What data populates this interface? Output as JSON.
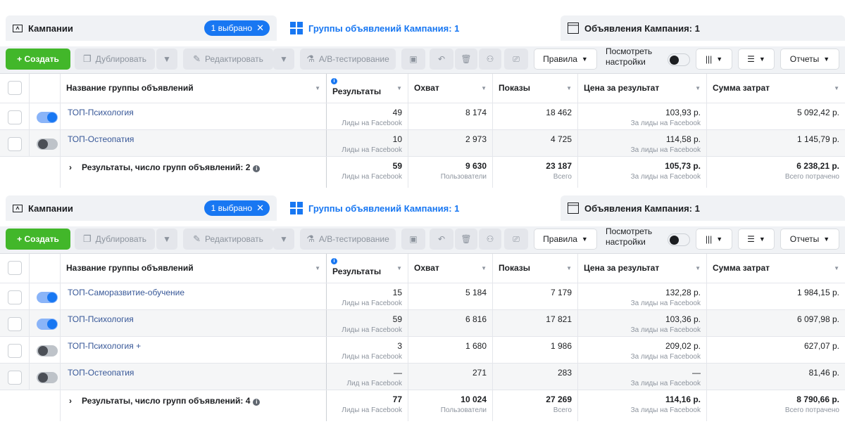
{
  "colors": {
    "accent": "#1877f2",
    "create": "#42b72a",
    "link": "#385898"
  },
  "panels": [
    {
      "tabs": {
        "campaigns": "Кампании",
        "selected_pill": "1 выбрано",
        "ad_sets": "Группы объявлений Кампания: 1",
        "ads": "Объявления Кампания: 1"
      },
      "toolbar": {
        "create": "+ Создать",
        "duplicate": "Дублировать",
        "edit": "Редактировать",
        "ab_test": "A/B-тестирование",
        "rules": "Правила",
        "view_settings_1": "Посмотреть",
        "view_settings_2": "настройки",
        "reports": "Отчеты"
      },
      "columns": {
        "name": "Название группы объявлений",
        "results": "Результаты",
        "reach": "Охват",
        "impressions": "Показы",
        "cost_per_result": "Цена за результат",
        "amount_spent": "Сумма затрат"
      },
      "rows": [
        {
          "toggle": "on",
          "name": "ТОП-Психология",
          "results": "49",
          "results_sub": "Лиды на Facebook",
          "reach": "8 174",
          "impressions": "18 462",
          "cpr": "103,93 р.",
          "cpr_sub": "За лиды на Facebook",
          "spend": "5 092,42 р."
        },
        {
          "toggle": "off",
          "name": "ТОП-Остеопатия",
          "results": "10",
          "results_sub": "Лиды на Facebook",
          "reach": "2 973",
          "impressions": "4 725",
          "cpr": "114,58 р.",
          "cpr_sub": "За лиды на Facebook",
          "spend": "1 145,79 р."
        }
      ],
      "total": {
        "label": "Результаты, число групп объявлений: 2",
        "results": "59",
        "results_sub": "Лиды на Facebook",
        "reach": "9 630",
        "reach_sub": "Пользователи",
        "impressions": "23 187",
        "impressions_sub": "Всего",
        "cpr": "105,73 р.",
        "cpr_sub": "За лиды на Facebook",
        "spend": "6 238,21 р.",
        "spend_sub": "Всего потрачено"
      }
    },
    {
      "tabs": {
        "campaigns": "Кампании",
        "selected_pill": "1 выбрано",
        "ad_sets": "Группы объявлений Кампания: 1",
        "ads": "Объявления Кампания: 1"
      },
      "toolbar": {
        "create": "+ Создать",
        "duplicate": "Дублировать",
        "edit": "Редактировать",
        "ab_test": "A/B-тестирование",
        "rules": "Правила",
        "view_settings_1": "Посмотреть",
        "view_settings_2": "настройки",
        "reports": "Отчеты"
      },
      "columns": {
        "name": "Название группы объявлений",
        "results": "Результаты",
        "reach": "Охват",
        "impressions": "Показы",
        "cost_per_result": "Цена за результат",
        "amount_spent": "Сумма затрат"
      },
      "rows": [
        {
          "toggle": "on",
          "name": "ТОП-Саморазвитие-обучение",
          "results": "15",
          "results_sub": "Лиды на Facebook",
          "reach": "5 184",
          "impressions": "7 179",
          "cpr": "132,28 р.",
          "cpr_sub": "За лиды на Facebook",
          "spend": "1 984,15 р."
        },
        {
          "toggle": "on",
          "name": "ТОП-Психология",
          "results": "59",
          "results_sub": "Лиды на Facebook",
          "reach": "6 816",
          "impressions": "17 821",
          "cpr": "103,36 р.",
          "cpr_sub": "За лиды на Facebook",
          "spend": "6 097,98 р."
        },
        {
          "toggle": "off",
          "name": "ТОП-Психология +",
          "results": "3",
          "results_sub": "Лиды на Facebook",
          "reach": "1 680",
          "impressions": "1 986",
          "cpr": "209,02 р.",
          "cpr_sub": "За лиды на Facebook",
          "spend": "627,07 р."
        },
        {
          "toggle": "off",
          "name": "ТОП-Остеопатия",
          "results": "—",
          "results_sub": "Лид на Facebook",
          "reach": "271",
          "impressions": "283",
          "cpr": "—",
          "cpr_sub": "За лиды на Facebook",
          "spend": "81,46 р."
        }
      ],
      "total": {
        "label": "Результаты, число групп объявлений: 4",
        "results": "77",
        "results_sub": "Лиды на Facebook",
        "reach": "10 024",
        "reach_sub": "Пользователи",
        "impressions": "27 269",
        "impressions_sub": "Всего",
        "cpr": "114,16 р.",
        "cpr_sub": "За лиды на Facebook",
        "spend": "8 790,66 р.",
        "spend_sub": "Всего потрачено"
      }
    }
  ]
}
